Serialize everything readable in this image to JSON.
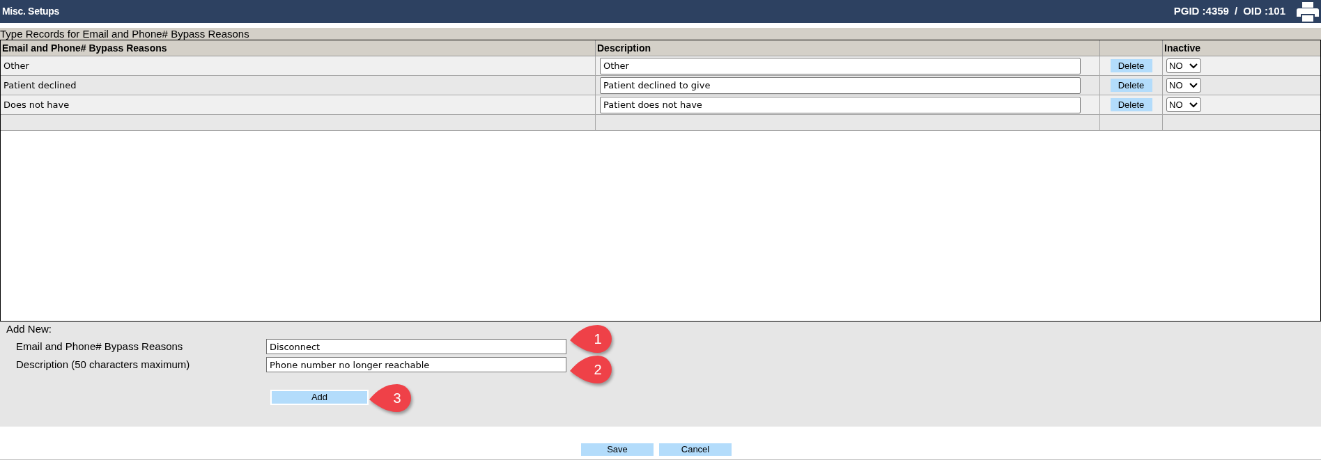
{
  "header": {
    "title": "Misc. Setups",
    "pgid": "PGID :4359",
    "separator": "/",
    "oid": "OID :101"
  },
  "section_title": "Type Records for Email and Phone# Bypass Reasons",
  "table": {
    "columns": [
      {
        "kind": "text",
        "label": "Email and Phone# Bypass Reasons"
      },
      {
        "kind": "input",
        "label": "Description"
      },
      {
        "kind": "action"
      },
      {
        "kind": "select",
        "label": "Inactive"
      }
    ],
    "rows": [
      {
        "cells": [
          "Other",
          "Other",
          "Delete",
          "NO"
        ]
      },
      {
        "cells": [
          "Patient declined",
          "Patient declined to give",
          "Delete",
          "NO"
        ]
      },
      {
        "cells": [
          "Does not have",
          "Patient does not have",
          "Delete",
          "NO"
        ]
      }
    ]
  },
  "add_new": {
    "title": "Add New:",
    "fields": [
      {
        "label": "Email and Phone# Bypass Reasons",
        "value": "Disconnect",
        "callout": "1"
      },
      {
        "label": "Description (50 characters maximum)",
        "value": "Phone number no longer reachable",
        "callout": "2"
      }
    ],
    "button": {
      "label": "Add",
      "callout": "3"
    }
  },
  "footer_buttons": [
    {
      "label": "Save"
    },
    {
      "label": "Cancel"
    }
  ]
}
